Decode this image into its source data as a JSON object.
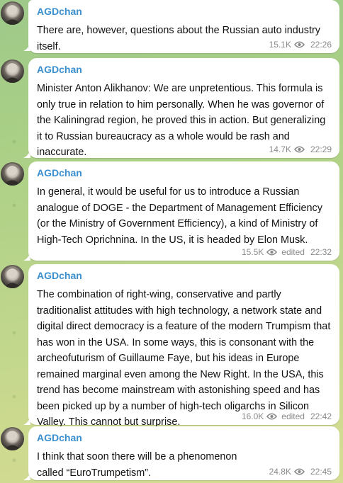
{
  "channel_author": "AGDchan",
  "messages": [
    {
      "author": "AGDchan",
      "text": "There are, however, questions about the Russian auto industry itself.",
      "views": "15.1K",
      "edited": "",
      "time": "22:26"
    },
    {
      "author": "AGDchan",
      "text": "Minister Anton Alikhanov: We are unpretentious. This formula is only true in relation to him personally. When he was governor of the Kaliningrad region, he proved this in action. But generalizing it to Russian bureaucracy as a whole would be rash and inaccurate.",
      "views": "14.7K",
      "edited": "",
      "time": "22:29"
    },
    {
      "author": "AGDchan",
      "text": "In general, it would be useful for us to introduce a Russian analogue of DOGE - the Department of Management Efficiency (or the Ministry of Government Efficiency), a kind of Ministry of High-Tech Oprichnina. In the US, it is headed by Elon Musk.",
      "views": "15.5K",
      "edited": "edited",
      "time": "22:32"
    },
    {
      "author": "AGDchan",
      "text": "The combination of right-wing, conservative and partly traditionalist attitudes with high technology, a network state and digital direct democracy is a feature of the modern Trumpism that has won in the USA. In some ways, this is consonant with the archeofuturism of Guillaume Faye, but his ideas in Europe remained marginal even among the New Right. In the USA, this trend has become mainstream with astonishing speed and has been picked up by a number of high-tech oligarchs in Silicon Valley. This cannot but surprise.",
      "views": "16.0K",
      "edited": "edited",
      "time": "22:42"
    },
    {
      "author": "AGDchan",
      "text": "I think that soon there will be a phenomenon called “EuroTrumpetism”.",
      "views": "24.8K",
      "edited": "",
      "time": "22:45"
    }
  ],
  "colors": {
    "author": "#3a8fcf",
    "meta": "#8a8a8a",
    "bubble": "#ffffff"
  },
  "icons": {
    "views": "eye-icon"
  }
}
